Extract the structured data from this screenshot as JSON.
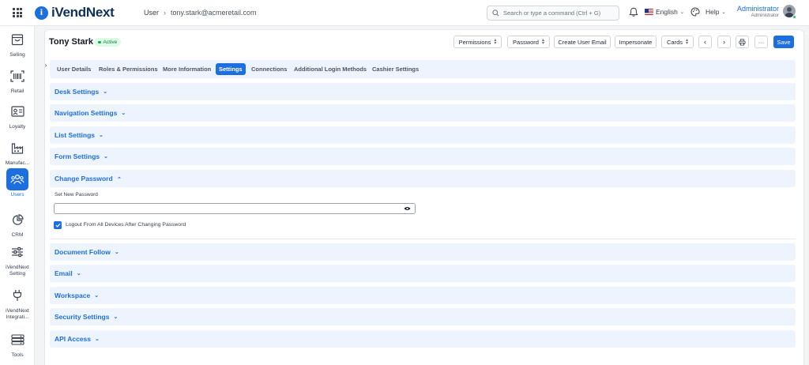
{
  "app": {
    "name": "iVendNext",
    "logo_letter": "i",
    "brand_color": "#1d6fe0"
  },
  "breadcrumb": {
    "root": "User",
    "current": "tony.stark@acmeretail.com"
  },
  "search": {
    "placeholder": "Search or type a command (Ctrl + G)"
  },
  "header": {
    "language": "English",
    "help": "Help",
    "user_name": "Administrator",
    "user_role": "Administrator"
  },
  "sidebar": {
    "items": [
      {
        "label": "Selling",
        "icon": "shop-icon"
      },
      {
        "label": "Retail",
        "icon": "barcode-icon"
      },
      {
        "label": "Loyalty",
        "icon": "id-card-icon"
      },
      {
        "label": "Manufac...",
        "icon": "factory-icon"
      },
      {
        "label": "Users",
        "icon": "users-icon",
        "active": true
      },
      {
        "label": "CRM",
        "icon": "pie-chart-icon"
      },
      {
        "label": "iVendNext Setting",
        "icon": "sliders-icon"
      },
      {
        "label": "iVendNext Integrati...",
        "icon": "plug-icon"
      },
      {
        "label": "Tools",
        "icon": "tools-icon"
      }
    ]
  },
  "doc": {
    "title": "Tony Stark",
    "status": "Active",
    "status_color": "#16a34a",
    "buttons": {
      "permissions": "Permissions",
      "password": "Password",
      "create_email": "Create User Email",
      "impersonate": "Impersonate",
      "cards": "Cards",
      "more": "···",
      "save": "Save"
    }
  },
  "tabs": [
    {
      "label": "User Details"
    },
    {
      "label": "Roles & Permissions"
    },
    {
      "label": "More Information"
    },
    {
      "label": "Settings",
      "active": true
    },
    {
      "label": "Connections"
    },
    {
      "label": "Additional Login Methods"
    },
    {
      "label": "Cashier Settings"
    }
  ],
  "sections": {
    "desk": "Desk Settings",
    "navigation": "Navigation Settings",
    "list": "List Settings",
    "form": "Form Settings",
    "change_password": "Change Password",
    "document_follow": "Document Follow",
    "email": "Email",
    "workspace": "Workspace",
    "security": "Security Settings",
    "api": "API Access"
  },
  "change_password": {
    "field_label": "Set New Password",
    "value": "",
    "logout_label": "Logout From All Devices After Changing Password",
    "logout_checked": true
  }
}
